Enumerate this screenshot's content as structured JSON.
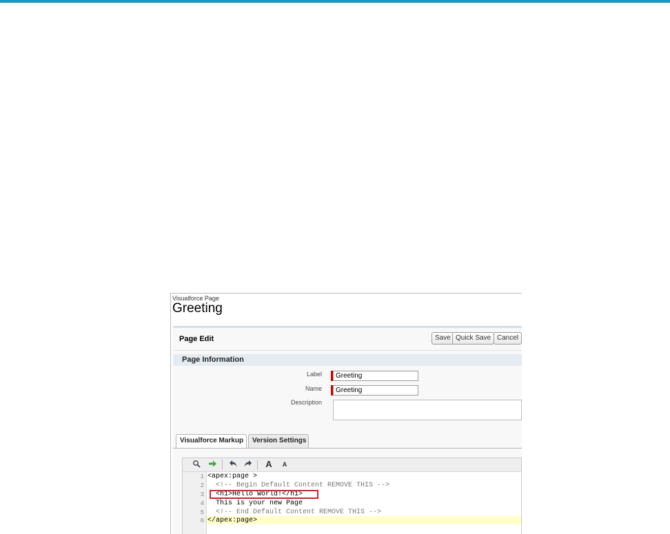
{
  "page": {
    "breadcrumb": "Visualforce Page",
    "title": "Greeting"
  },
  "page_edit": {
    "title": "Page Edit",
    "buttons": {
      "save": "Save",
      "quick_save": "Quick Save",
      "cancel": "Cancel"
    }
  },
  "page_information": {
    "title": "Page Information",
    "fields": {
      "label": {
        "label": "Label",
        "value": "Greeting"
      },
      "name": {
        "label": "Name",
        "value": "Greeting"
      },
      "description": {
        "label": "Description",
        "value": ""
      }
    }
  },
  "tabs": [
    {
      "label": "Visualforce Markup",
      "active": true
    },
    {
      "label": "Version Settings",
      "active": false
    }
  ],
  "toolbar_icons": [
    "search-icon",
    "go-to-line-icon",
    "undo-icon",
    "redo-icon",
    "increase-font-icon",
    "decrease-font-icon"
  ],
  "toolbar_glyphs": {
    "font_large": "A",
    "font_small": "A"
  },
  "code_lines": [
    {
      "n": "1",
      "text": "<apex:page >"
    },
    {
      "n": "2",
      "text": "  <!-- Begin Default Content REMOVE THIS -->"
    },
    {
      "n": "3",
      "text": "  <h1>Hello World!</h1>"
    },
    {
      "n": "4",
      "text": "  This is your new Page"
    },
    {
      "n": "5",
      "text": "  <!-- End Default Content REMOVE THIS -->"
    },
    {
      "n": "6",
      "text": "</apex:page>"
    }
  ],
  "colors": {
    "accent": "#1797c0",
    "required": "#cc0000",
    "highlight_box": "#c0272d",
    "current_line": "#ffffc8"
  }
}
